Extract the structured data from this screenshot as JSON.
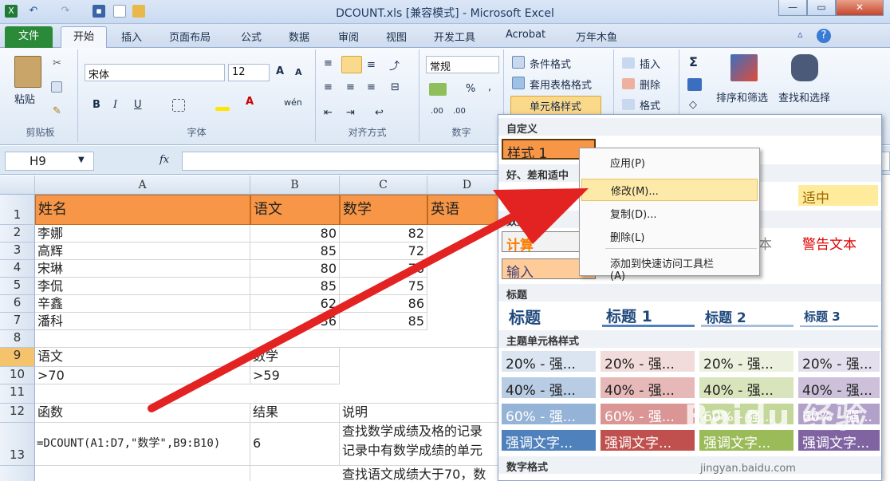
{
  "window": {
    "title": "DCOUNT.xls [兼容模式] - Microsoft Excel"
  },
  "tabs": [
    "文件",
    "开始",
    "插入",
    "页面布局",
    "公式",
    "数据",
    "审阅",
    "视图",
    "开发工具",
    "Acrobat",
    "万年木鱼"
  ],
  "ribbon": {
    "clipboard": {
      "paste": "粘贴",
      "group": "剪贴板"
    },
    "font": {
      "name": "宋体",
      "size": "12",
      "group": "字体"
    },
    "align": {
      "group": "对齐方式"
    },
    "number": {
      "format": "常规",
      "group": "数字",
      "percent": "%",
      "comma": ","
    },
    "styles": {
      "conditional": "条件格式",
      "table": "套用表格格式",
      "cell": "单元格样式"
    },
    "cells": {
      "insert": "插入",
      "delete": "删除",
      "format": "格式"
    },
    "edit": {
      "sort": "排序和筛选",
      "find": "查找和选择"
    }
  },
  "formula_bar": {
    "name_box": "H9",
    "fx": "fx"
  },
  "sheet": {
    "columns": [
      "A",
      "B",
      "C",
      "D"
    ],
    "rows": [
      "1",
      "2",
      "3",
      "4",
      "5",
      "6",
      "7",
      "8",
      "9",
      "10",
      "11",
      "12",
      "13",
      ""
    ],
    "cells": {
      "a1": "姓名",
      "b1": "语文",
      "c1": "数学",
      "d1": "英语",
      "a2": "李娜",
      "b2": "80",
      "c2": "82",
      "a3": "高辉",
      "b3": "85",
      "c3": "72",
      "a4": "宋琳",
      "b4": "80",
      "c4": "76",
      "a5": "李侃",
      "b5": "85",
      "c5": "75",
      "a6": "辛鑫",
      "b6": "62",
      "c6": "86",
      "a7": "潘科",
      "b7": "36",
      "c7": "85",
      "a9": "语文",
      "b9": "数学",
      "a10": ">70",
      "b10": ">59",
      "a12": "函数",
      "b12": "结果",
      "c12": "说明",
      "a13": "=DCOUNT(A1:D7,\"数学\",B9:B10)",
      "b13": "6",
      "c13a": "查找数学成绩及格的记录",
      "c13b": "记录中有数学成绩的单元",
      "c14": "查找语文成绩大于70，数"
    }
  },
  "gallery": {
    "custom_header": "自定义",
    "custom_style": "样式 1",
    "good_bad_header": "好、差和适中",
    "normal": "常规",
    "neutral": "适中",
    "data_header": "数据",
    "calc": "计算",
    "input": "输入",
    "explain": "文本",
    "warning": "警告文本",
    "title_header": "标题",
    "titles": [
      "标题",
      "标题 1",
      "标题 2",
      "标题 3"
    ],
    "theme_header": "主题单元格样式",
    "row20": [
      "20% - 强...",
      "20% - 强...",
      "20% - 强...",
      "20% - 强..."
    ],
    "row40": [
      "40% - 强...",
      "40% - 强...",
      "40% - 强...",
      "40% - 强..."
    ],
    "row60": [
      "60% - 强...",
      "60% - 强...",
      "60% - 强...",
      "60% - 强..."
    ],
    "accent": [
      "强调文字...",
      "强调文字...",
      "强调文字...",
      "强调文字..."
    ],
    "number_header": "数字格式"
  },
  "context_menu": {
    "items": [
      "应用(P)",
      "修改(M)...",
      "复制(D)...",
      "删除(L)",
      "添加到快速访问工具栏(A)"
    ]
  },
  "watermark": {
    "logo": "Baidu 经验",
    "url": "jingyan.baidu.com"
  },
  "colors": {
    "header_orange": "#f79646",
    "accent_green": "#2a8a3a",
    "arrow_red": "#e32222"
  }
}
